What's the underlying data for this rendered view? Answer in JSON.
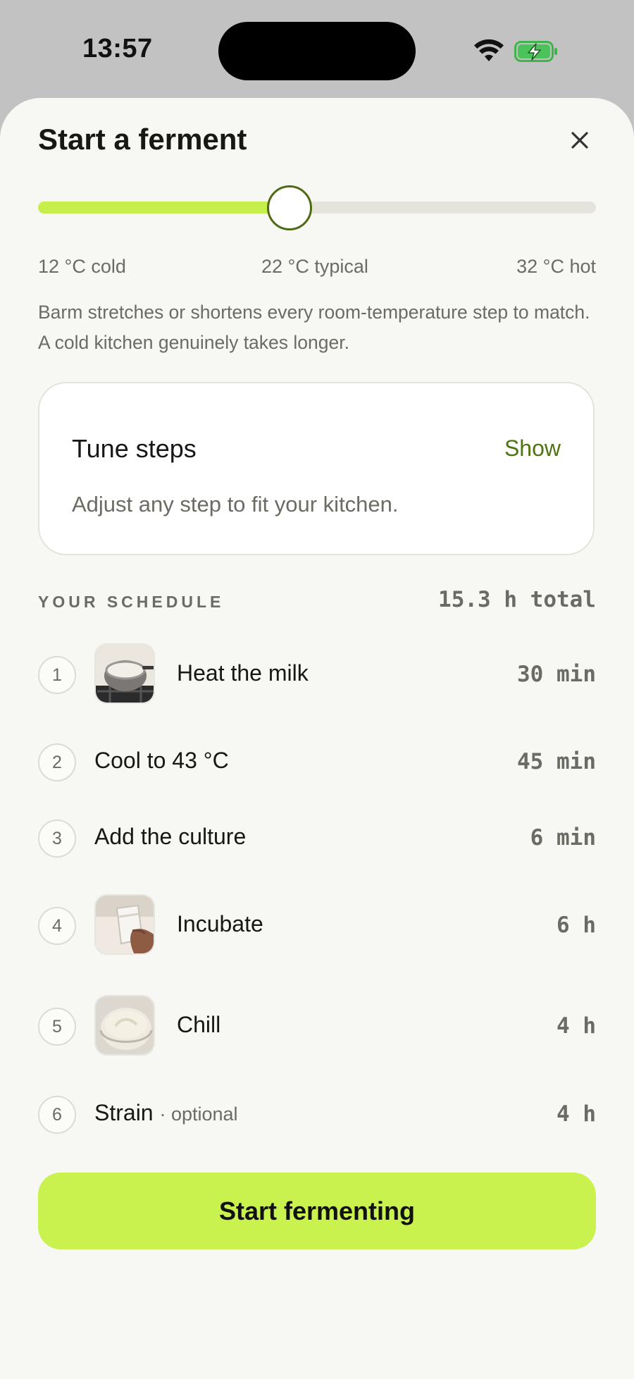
{
  "status_bar": {
    "time": "13:57"
  },
  "sheet": {
    "title": "Start a ferment",
    "temperature": {
      "cold_label": "12 °C cold",
      "typical_label": "22 °C typical",
      "hot_label": "32 °C hot",
      "slider_value_fraction": 0.45
    },
    "description": "Barm stretches or shortens every room-temperature step to match. A cold kitchen genuinely takes longer.",
    "tune_card": {
      "title": "Tune steps",
      "toggle_label": "Show",
      "description": "Adjust any step to fit your kitchen."
    },
    "schedule": {
      "section_title": "YOUR SCHEDULE",
      "total": "15.3 h total",
      "steps": [
        {
          "number": "1",
          "label": "Heat the milk",
          "suffix": "",
          "duration": "30 min",
          "thumbnail": "milk-pot-photo"
        },
        {
          "number": "2",
          "label": "Cool to 43 °C",
          "suffix": "",
          "duration": "45 min",
          "thumbnail": ""
        },
        {
          "number": "3",
          "label": "Add the culture",
          "suffix": "",
          "duration": "6 min",
          "thumbnail": ""
        },
        {
          "number": "4",
          "label": "Incubate",
          "suffix": "",
          "duration": "6 h",
          "thumbnail": "jar-photo"
        },
        {
          "number": "5",
          "label": "Chill",
          "suffix": "",
          "duration": "4 h",
          "thumbnail": "yogurt-bowl-photo"
        },
        {
          "number": "6",
          "label": "Strain",
          "suffix": "· optional",
          "duration": "4 h",
          "thumbnail": ""
        }
      ]
    },
    "cta_label": "Start fermenting"
  },
  "colors": {
    "accent": "#c9f24e",
    "accent_dark": "#4f7512",
    "muted_text": "#6a6c64",
    "sheet_bg": "#f7f7f3"
  }
}
